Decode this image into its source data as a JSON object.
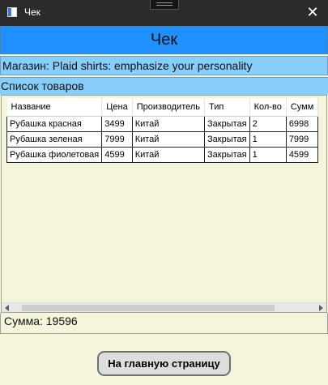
{
  "window": {
    "title": "Чек",
    "close_glyph": "✕"
  },
  "header": {
    "title": "Чек"
  },
  "store": {
    "label": "Магазин: Plaid shirts: emphasize your personality"
  },
  "list": {
    "label": "Список товаров"
  },
  "table": {
    "headers": [
      "Название",
      "Цена",
      "Производитель",
      "Тип",
      "Кол-во",
      "Сумм"
    ],
    "rows": [
      [
        "Рубашка красная",
        "3499",
        "Китай",
        "Закрытая",
        "2",
        "6998"
      ],
      [
        "Рубашка зеленая",
        "7999",
        "Китай",
        "Закрытая",
        "1",
        "7999"
      ],
      [
        "Рубашка фиолетовая",
        "4599",
        "Китай",
        "Закрытая",
        "1",
        "4599"
      ]
    ]
  },
  "total": {
    "label": "Сумма: 19596"
  },
  "buttons": {
    "main_page": "На главную страницу"
  },
  "colors": {
    "header_bg": "#1e90ff",
    "bar_bg": "#87cefa",
    "page_bg": "#f5f5dc",
    "titlebar_bg": "#2b2b2b"
  }
}
